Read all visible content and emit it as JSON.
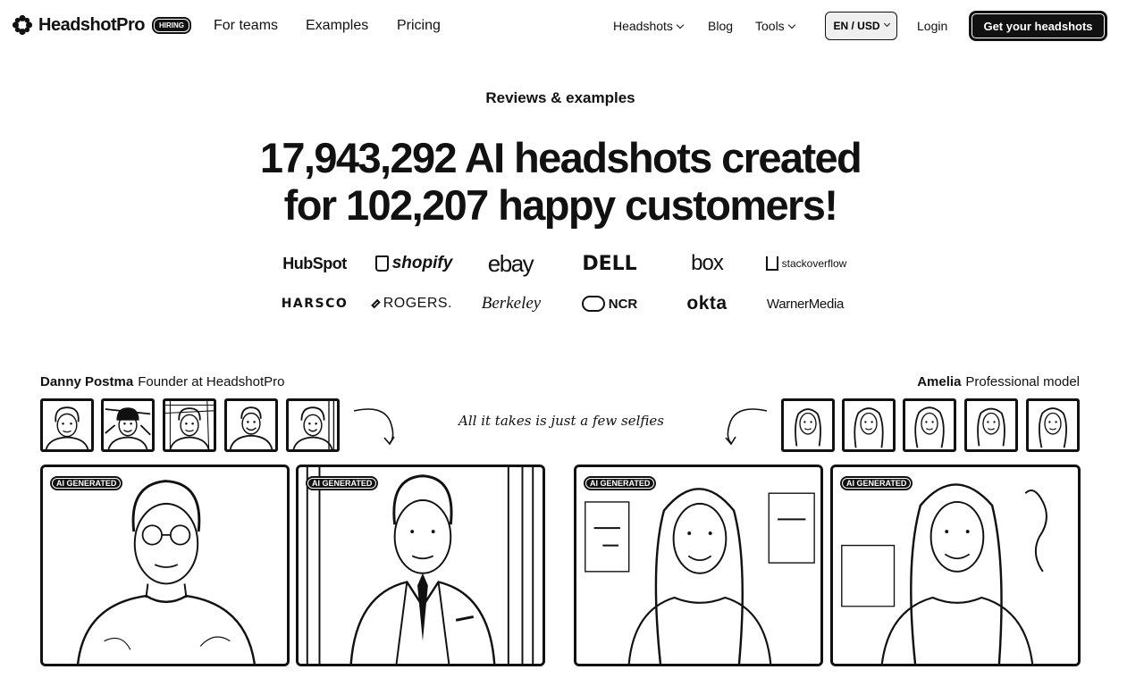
{
  "nav": {
    "brand": "HeadshotPro",
    "hiring_badge": "HIRING",
    "links": [
      "For teams",
      "Examples",
      "Pricing"
    ],
    "right_links": {
      "headshots": "Headshots",
      "blog": "Blog",
      "tools": "Tools"
    },
    "lang": "EN / USD",
    "login": "Login",
    "cta": "Get your headshots"
  },
  "hero": {
    "eyebrow": "Reviews & examples",
    "line1_num": "17,943,292",
    "line1_text": " AI headshots created",
    "line2_prefix": "for ",
    "line2_num": "102,207",
    "line2_text": " happy customers!"
  },
  "logos": [
    "HubSpot",
    "shopify",
    "ebay",
    "DELL",
    "box",
    "stackoverflow",
    "HARSCO",
    "ROGERS.",
    "Berkeley",
    "NCR",
    "okta",
    "WarnerMedia"
  ],
  "profiles": {
    "left": {
      "name": "Danny Postma",
      "role": "Founder at HeadshotPro"
    },
    "right": {
      "name": "Amelia",
      "role": "Professional model"
    },
    "note": "All it takes is just a few selfies",
    "badge": "AI GENERATED"
  },
  "icons": {
    "brand": "flower-logo-icon",
    "arrow": "curved-arrow-icon",
    "chevron": "chevron-down-icon"
  }
}
